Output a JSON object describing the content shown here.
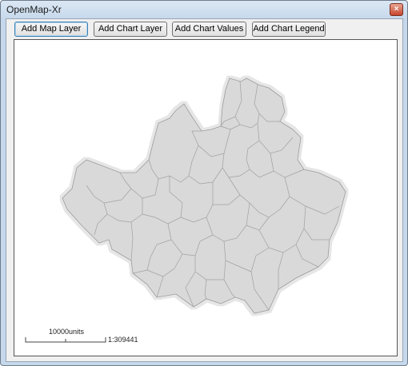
{
  "window": {
    "title": "OpenMap-Xr",
    "close_symbol": "×"
  },
  "toolbar": {
    "add_map_layer": "Add Map Layer",
    "add_chart_layer": "Add Chart Layer",
    "add_chart_values": "Add Chart Values",
    "add_chart_legend": "Add Chart Legend"
  },
  "map": {
    "fill_color": "#d9d9d9",
    "boundary_color": "#9a9a9a",
    "halo_color": "#e8e8e8",
    "scale_label": "10000units",
    "scale_ratio": "1:309441"
  }
}
